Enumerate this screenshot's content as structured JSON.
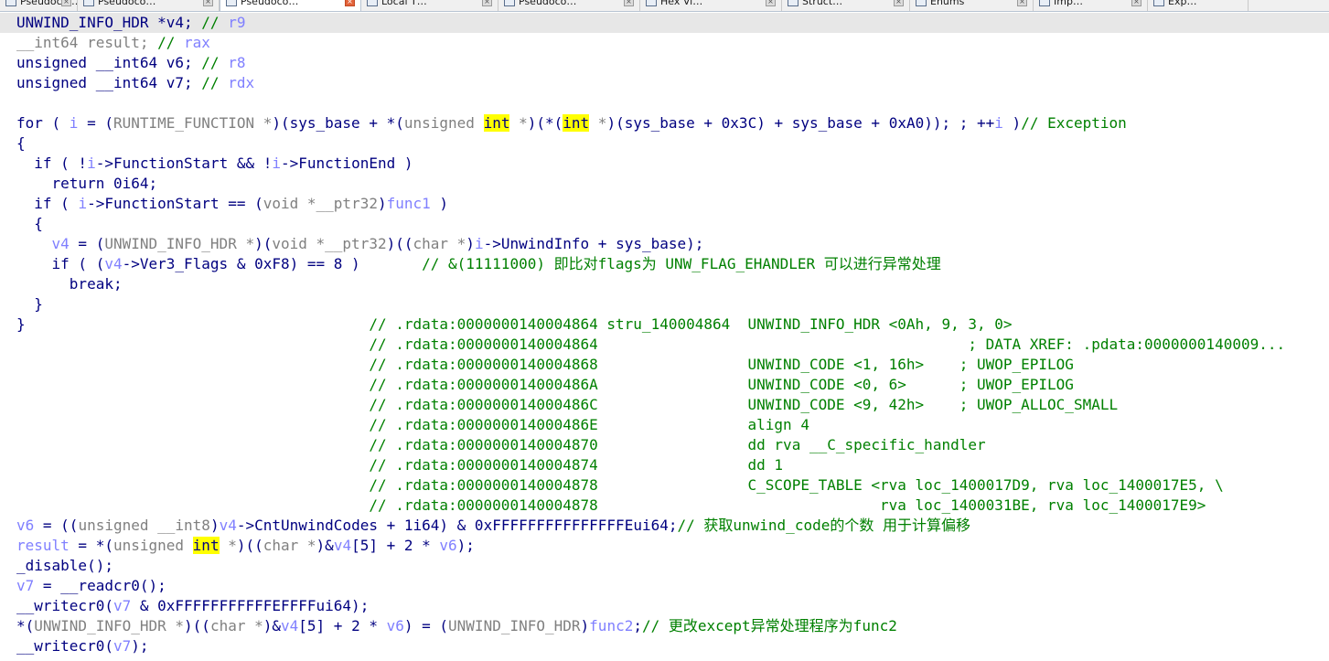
{
  "tabs": [
    {
      "label": "Pseudoco…",
      "active": false
    },
    {
      "label": "Pseudoco…",
      "active": false
    },
    {
      "label": "Pseudoco…",
      "active": true
    },
    {
      "label": "Local T…",
      "active": false
    },
    {
      "label": "Pseudoco…",
      "active": false
    },
    {
      "label": "Hex Vi…",
      "active": false
    },
    {
      "label": "Struct…",
      "active": false
    },
    {
      "label": "Enums",
      "active": false
    },
    {
      "label": "Imp…",
      "active": false
    },
    {
      "label": "Exp…",
      "active": false
    }
  ],
  "code_lines": [
    [
      [
        "t",
        "UNWIND_INFO_HDR *v4; "
      ],
      [
        "c",
        "// "
      ],
      [
        "v",
        "r9"
      ]
    ],
    [
      [
        "ty",
        "__int64 result; "
      ],
      [
        "c",
        "// "
      ],
      [
        "v",
        "rax"
      ]
    ],
    [
      [
        "t",
        "unsigned __int64 v6; "
      ],
      [
        "c",
        "// "
      ],
      [
        "v",
        "r8"
      ]
    ],
    [
      [
        "t",
        "unsigned __int64 v7; "
      ],
      [
        "c",
        "// "
      ],
      [
        "v",
        "rdx"
      ]
    ],
    [],
    [
      [
        "t",
        "for ( "
      ],
      [
        "v",
        "i"
      ],
      [
        "t",
        " = ("
      ],
      [
        "ty",
        "RUNTIME_FUNCTION *"
      ],
      [
        "t",
        ")(sys_base + *("
      ],
      [
        "ty",
        "unsigned "
      ],
      [
        "hl",
        "int"
      ],
      [
        "ty",
        " *"
      ],
      [
        "t",
        ")(*("
      ],
      [
        "hl",
        "int"
      ],
      [
        "ty",
        " *"
      ],
      [
        "t",
        ")(sys_base + 0x3C) + sys_base + 0xA0)); ; ++"
      ],
      [
        "v",
        "i"
      ],
      [
        "t",
        " )"
      ],
      [
        "c",
        "// Exception"
      ]
    ],
    [
      [
        "t",
        "{"
      ]
    ],
    [
      [
        "t",
        "  if ( !"
      ],
      [
        "v",
        "i"
      ],
      [
        "t",
        "->FunctionStart && !"
      ],
      [
        "v",
        "i"
      ],
      [
        "t",
        "->FunctionEnd )"
      ]
    ],
    [
      [
        "t",
        "    return 0i64;"
      ]
    ],
    [
      [
        "t",
        "  if ( "
      ],
      [
        "v",
        "i"
      ],
      [
        "t",
        "->FunctionStart == ("
      ],
      [
        "ty",
        "void *__ptr32"
      ],
      [
        "t",
        ")"
      ],
      [
        "v",
        "func1"
      ],
      [
        "t",
        " )"
      ]
    ],
    [
      [
        "t",
        "  {"
      ]
    ],
    [
      [
        "t",
        "    "
      ],
      [
        "v",
        "v4"
      ],
      [
        "t",
        " = ("
      ],
      [
        "ty",
        "UNWIND_INFO_HDR *"
      ],
      [
        "t",
        ")("
      ],
      [
        "ty",
        "void *__ptr32"
      ],
      [
        "t",
        ")(("
      ],
      [
        "ty",
        "char *"
      ],
      [
        "t",
        ")"
      ],
      [
        "v",
        "i"
      ],
      [
        "t",
        "->UnwindInfo + sys_base);"
      ]
    ],
    [
      [
        "t",
        "    if ( ("
      ],
      [
        "v",
        "v4"
      ],
      [
        "t",
        "->Ver3_Flags & 0xF8) == 8 )       "
      ],
      [
        "c",
        "// &(11111000) 即比对flags为 UNW_FLAG_EHANDLER 可以进行异常处理"
      ]
    ],
    [
      [
        "t",
        "      break;"
      ]
    ],
    [
      [
        "t",
        "  }"
      ]
    ],
    [
      [
        "t",
        "}                                       "
      ],
      [
        "c",
        "// .rdata:0000000140004864 stru_140004864  UNWIND_INFO_HDR <0Ah, 9, 3, 0>"
      ]
    ],
    [
      [
        "t",
        "                                        "
      ],
      [
        "c",
        "// .rdata:0000000140004864                                          ; DATA XREF: .pdata:0000000140009..."
      ]
    ],
    [
      [
        "t",
        "                                        "
      ],
      [
        "c",
        "// .rdata:0000000140004868                 UNWIND_CODE <1, 16h>    ; UWOP_EPILOG"
      ]
    ],
    [
      [
        "t",
        "                                        "
      ],
      [
        "c",
        "// .rdata:000000014000486A                 UNWIND_CODE <0, 6>      ; UWOP_EPILOG"
      ]
    ],
    [
      [
        "t",
        "                                        "
      ],
      [
        "c",
        "// .rdata:000000014000486C                 UNWIND_CODE <9, 42h>    ; UWOP_ALLOC_SMALL"
      ]
    ],
    [
      [
        "t",
        "                                        "
      ],
      [
        "c",
        "// .rdata:000000014000486E                 align 4"
      ]
    ],
    [
      [
        "t",
        "                                        "
      ],
      [
        "c",
        "// .rdata:0000000140004870                 dd rva __C_specific_handler"
      ]
    ],
    [
      [
        "t",
        "                                        "
      ],
      [
        "c",
        "// .rdata:0000000140004874                 dd 1"
      ]
    ],
    [
      [
        "t",
        "                                        "
      ],
      [
        "c",
        "// .rdata:0000000140004878                 C_SCOPE_TABLE <rva loc_1400017D9, rva loc_1400017E5, \\"
      ]
    ],
    [
      [
        "t",
        "                                        "
      ],
      [
        "c",
        "// .rdata:0000000140004878                                rva loc_1400031BE, rva loc_1400017E9>"
      ]
    ],
    [
      [
        "v",
        "v6"
      ],
      [
        "t",
        " = (("
      ],
      [
        "ty",
        "unsigned __int8"
      ],
      [
        "t",
        ")"
      ],
      [
        "v",
        "v4"
      ],
      [
        "t",
        "->CntUnwindCodes + 1i64) & 0xFFFFFFFFFFFFFFFEui64;"
      ],
      [
        "c",
        "// 获取unwind_code的个数 用于计算偏移"
      ]
    ],
    [
      [
        "v",
        "result"
      ],
      [
        "t",
        " = *("
      ],
      [
        "ty",
        "unsigned "
      ],
      [
        "hl",
        "int"
      ],
      [
        "ty",
        " *"
      ],
      [
        "t",
        ")(("
      ],
      [
        "ty",
        "char *"
      ],
      [
        "t",
        ")&"
      ],
      [
        "v",
        "v4"
      ],
      [
        "t",
        "[5] + 2 * "
      ],
      [
        "v",
        "v6"
      ],
      [
        "t",
        ");"
      ]
    ],
    [
      [
        "t",
        "_disable();"
      ]
    ],
    [
      [
        "v",
        "v7"
      ],
      [
        "t",
        " = __readcr0();"
      ]
    ],
    [
      [
        "t",
        "__writecr0("
      ],
      [
        "v",
        "v7"
      ],
      [
        "t",
        " & 0xFFFFFFFFFFFEFFFFui64);"
      ]
    ],
    [
      [
        "t",
        "*("
      ],
      [
        "ty",
        "UNWIND_INFO_HDR *"
      ],
      [
        "t",
        ")(("
      ],
      [
        "ty",
        "char *"
      ],
      [
        "t",
        ")&"
      ],
      [
        "v",
        "v4"
      ],
      [
        "t",
        "[5] + 2 * "
      ],
      [
        "v",
        "v6"
      ],
      [
        "t",
        ") = ("
      ],
      [
        "ty",
        "UNWIND_INFO_HDR"
      ],
      [
        "t",
        ")"
      ],
      [
        "v",
        "func2"
      ],
      [
        "t",
        ";"
      ],
      [
        "c",
        "// 更改except异常处理程序为func2"
      ]
    ],
    [
      [
        "t",
        "__writecr0("
      ],
      [
        "v",
        "v7"
      ],
      [
        "t",
        ");"
      ]
    ]
  ]
}
